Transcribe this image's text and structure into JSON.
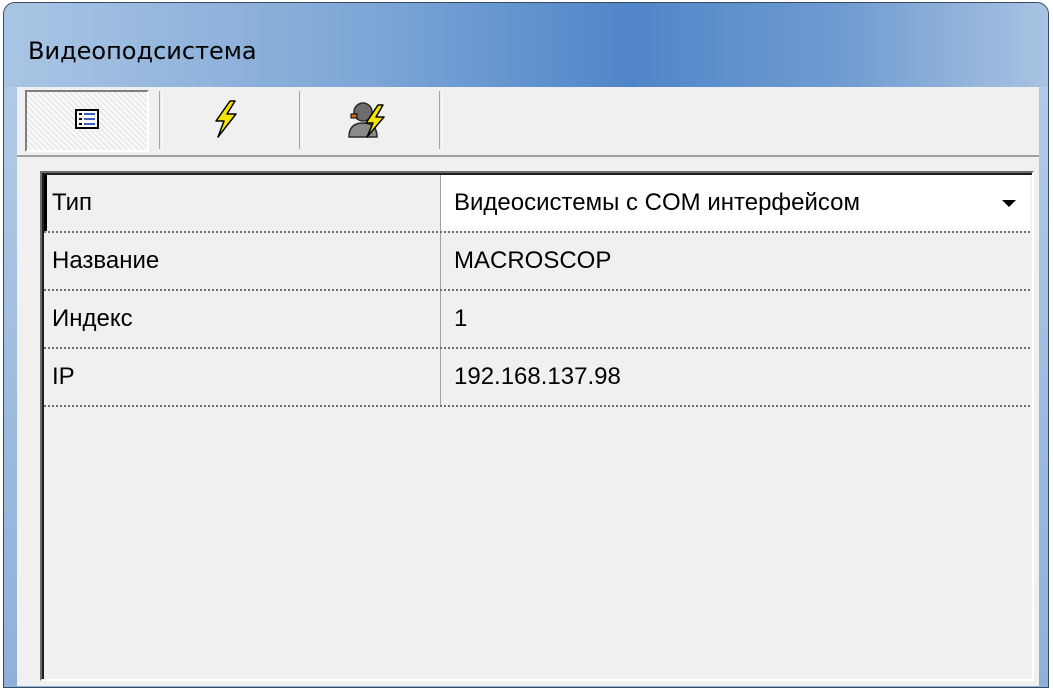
{
  "window": {
    "title": "Видеоподсистема"
  },
  "toolbar": {
    "buttons": [
      {
        "icon": "properties-list-icon",
        "pressed": true
      },
      {
        "icon": "lightning-icon",
        "pressed": false
      },
      {
        "icon": "user-lightning-icon",
        "pressed": false
      }
    ]
  },
  "properties": [
    {
      "label": "Тип",
      "value": "Видеосистемы с COM интерфейсом",
      "dropdown": true
    },
    {
      "label": "Название",
      "value": "MACROSCOP"
    },
    {
      "label": "Индекс",
      "value": "1"
    },
    {
      "label": "IP",
      "value": "192.168.137.98"
    }
  ],
  "colors": {
    "title_gradient_center": "#4f86c9",
    "client_bg": "#f0f0f0",
    "lightning": "#f5e400"
  }
}
